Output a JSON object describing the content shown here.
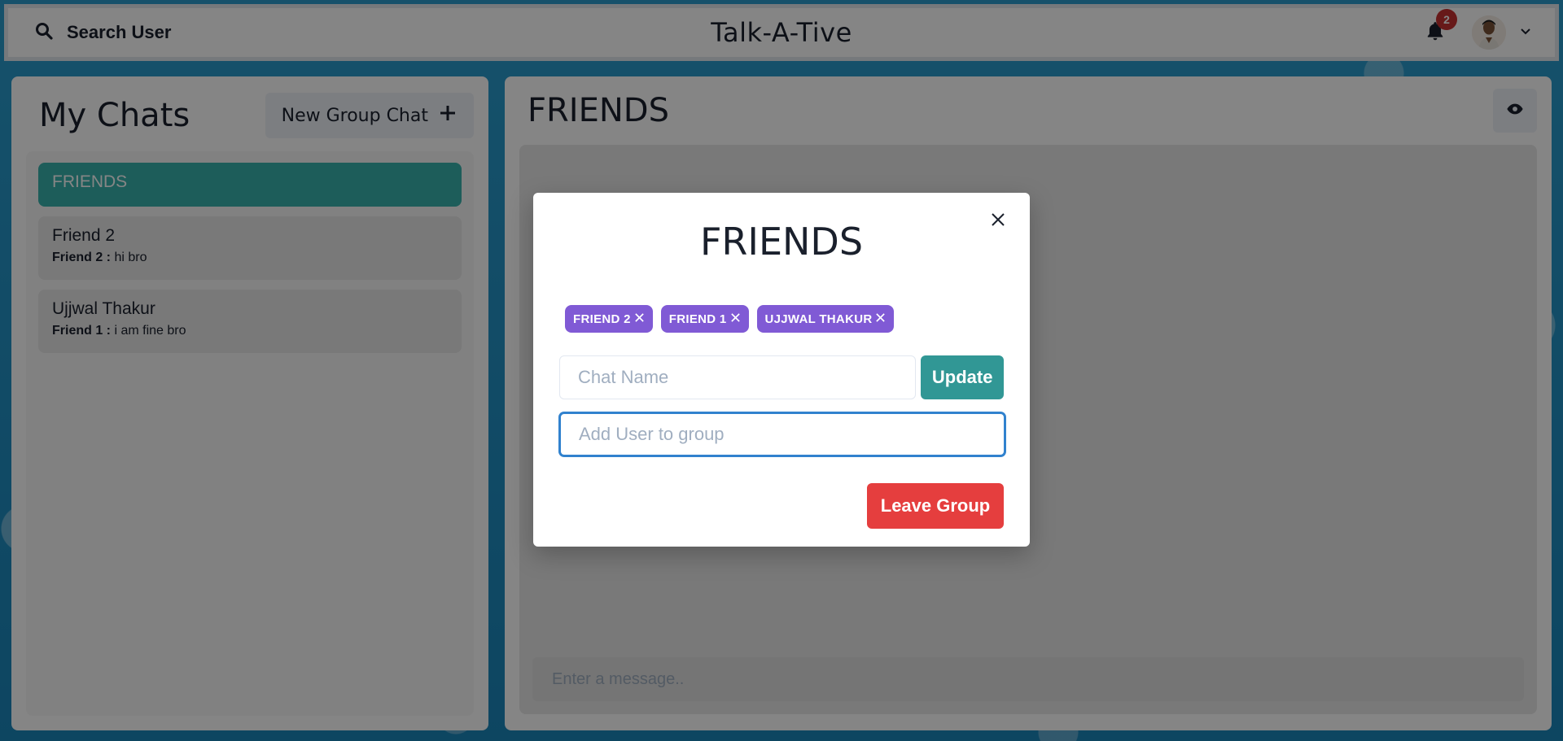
{
  "header": {
    "search_label": "Search User",
    "app_title": "Talk-A-Tive",
    "notification_count": "2"
  },
  "sidebar": {
    "title": "My Chats",
    "new_group_label": "New Group Chat",
    "chats": [
      {
        "name": "FRIENDS",
        "active": true
      },
      {
        "name": "Friend 2",
        "latest_sender": "Friend 2 :",
        "latest_message": "hi bro"
      },
      {
        "name": "Ujjwal Thakur",
        "latest_sender": "Friend 1 :",
        "latest_message": "i am fine bro"
      }
    ]
  },
  "chat": {
    "title": "FRIENDS",
    "message_placeholder": "Enter a message.."
  },
  "modal": {
    "title": "FRIENDS",
    "members": [
      "FRIEND 2",
      "FRIEND 1",
      "UJJWAL THAKUR"
    ],
    "chat_name_placeholder": "Chat Name",
    "update_label": "Update",
    "add_user_placeholder": "Add User to group",
    "leave_label": "Leave Group"
  },
  "colors": {
    "active_chat": "#38b2ac",
    "member_badge": "#805ad5",
    "update_button": "#319795",
    "leave_button": "#e53e3e",
    "notification_badge": "#c53030"
  }
}
